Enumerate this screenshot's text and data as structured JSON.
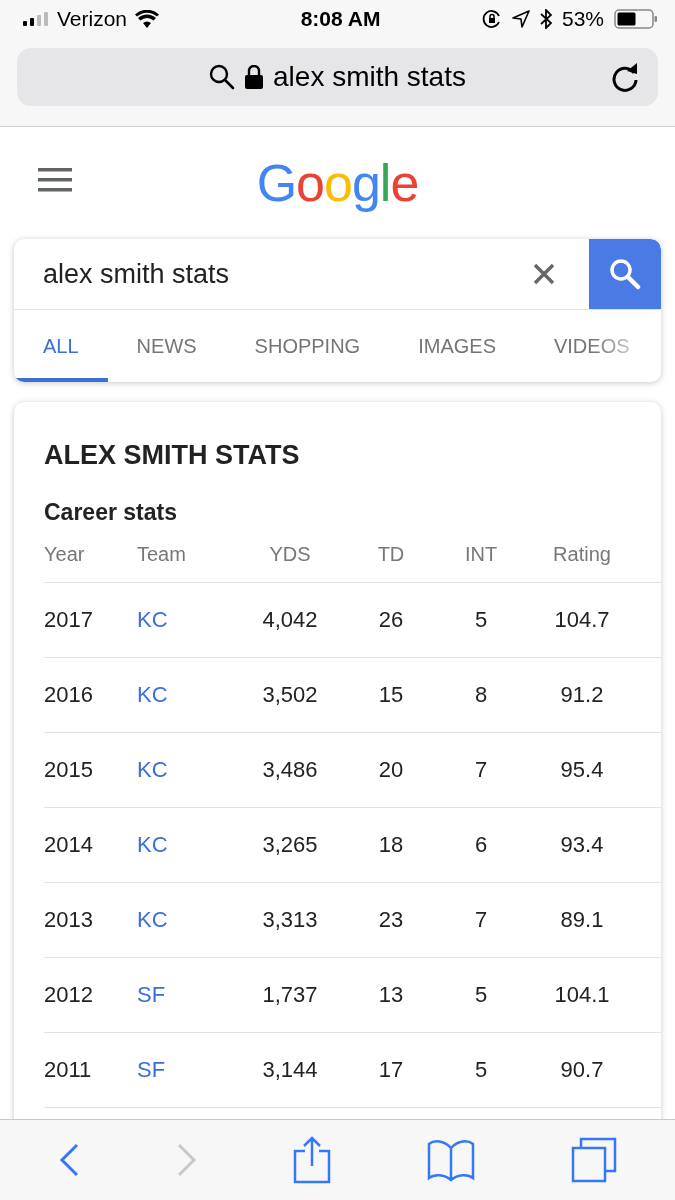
{
  "status_bar": {
    "carrier": "Verizon",
    "time": "8:08 AM",
    "battery": "53%"
  },
  "address_bar": {
    "value": "alex smith stats"
  },
  "logo": "Google",
  "search": {
    "value": "alex smith stats"
  },
  "tabs": [
    {
      "label": "ALL",
      "selected": true
    },
    {
      "label": "NEWS",
      "selected": false
    },
    {
      "label": "SHOPPING",
      "selected": false
    },
    {
      "label": "IMAGES",
      "selected": false
    },
    {
      "label": "VIDEOS",
      "selected": false
    }
  ],
  "result": {
    "title": "ALEX SMITH STATS",
    "subtitle": "Career stats",
    "columns": [
      "Year",
      "Team",
      "YDS",
      "TD",
      "INT",
      "Rating"
    ],
    "rows": [
      [
        "2017",
        "KC",
        "4,042",
        "26",
        "5",
        "104.7"
      ],
      [
        "2016",
        "KC",
        "3,502",
        "15",
        "8",
        "91.2"
      ],
      [
        "2015",
        "KC",
        "3,486",
        "20",
        "7",
        "95.4"
      ],
      [
        "2014",
        "KC",
        "3,265",
        "18",
        "6",
        "93.4"
      ],
      [
        "2013",
        "KC",
        "3,313",
        "23",
        "7",
        "89.1"
      ],
      [
        "2012",
        "SF",
        "1,737",
        "13",
        "5",
        "104.1"
      ],
      [
        "2011",
        "SF",
        "3,144",
        "17",
        "5",
        "90.7"
      ]
    ]
  }
}
